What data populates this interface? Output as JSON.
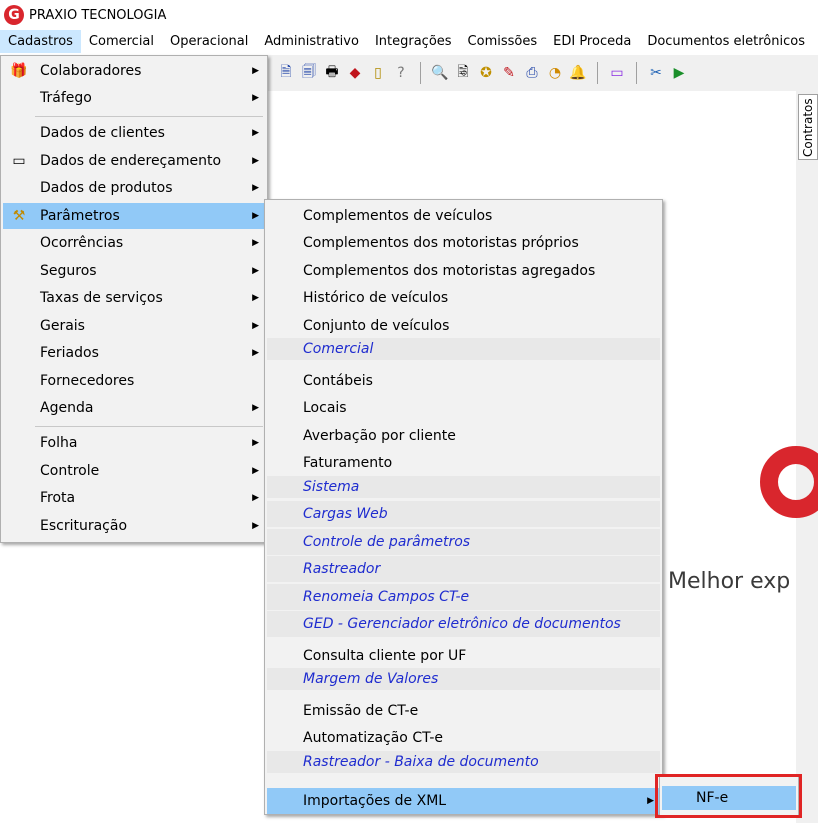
{
  "app": {
    "title": "PRAXIO TECNOLOGIA",
    "logo_letter": "G"
  },
  "menubar": [
    "Cadastros",
    "Comercial",
    "Operacional",
    "Administrativo",
    "Integrações",
    "Comissões",
    "EDI Proceda",
    "Documentos eletrônicos"
  ],
  "content": {
    "contratos_tab": "Contratos",
    "brand_text": "Melhor exp"
  },
  "menu_cadastros": {
    "items": [
      {
        "label": "Colaboradores",
        "icon": "gift-icon",
        "arrow": true
      },
      {
        "label": "Tráfego",
        "arrow": true
      },
      {
        "label": "Dados de clientes",
        "arrow": true
      },
      {
        "label": "Dados de endereçamento",
        "icon": "address-card-icon",
        "arrow": true
      },
      {
        "label": "Dados de produtos",
        "arrow": true
      },
      {
        "label": "Parâmetros",
        "icon": "tools-icon",
        "arrow": true
      },
      {
        "label": "Ocorrências",
        "arrow": true
      },
      {
        "label": "Seguros",
        "arrow": true
      },
      {
        "label": "Taxas de serviços",
        "arrow": true
      },
      {
        "label": "Gerais",
        "arrow": true
      },
      {
        "label": "Feriados",
        "arrow": true
      },
      {
        "label": "Fornecedores",
        "arrow": false
      },
      {
        "label": "Agenda",
        "arrow": true
      },
      {
        "label": "Folha",
        "arrow": true
      },
      {
        "label": "Controle",
        "arrow": true
      },
      {
        "label": "Frota",
        "arrow": true
      },
      {
        "label": "Escrituração",
        "arrow": true
      }
    ]
  },
  "menu_parametros": {
    "items": [
      {
        "label": "Complementos de veículos",
        "kind": "item"
      },
      {
        "label": "Complementos dos motoristas próprios",
        "kind": "item"
      },
      {
        "label": "Complementos dos motoristas agregados",
        "kind": "item"
      },
      {
        "label": "Histórico de veículos",
        "kind": "item"
      },
      {
        "label": "Conjunto de veículos",
        "kind": "item"
      },
      {
        "label": "Comercial",
        "kind": "category"
      },
      {
        "label": "Contábeis",
        "kind": "item"
      },
      {
        "label": "Locais",
        "kind": "item"
      },
      {
        "label": "Averbação por cliente",
        "kind": "item"
      },
      {
        "label": "Faturamento",
        "kind": "item"
      },
      {
        "label": "Sistema",
        "kind": "category"
      },
      {
        "label": "Cargas Web",
        "kind": "category"
      },
      {
        "label": "Controle de parâmetros",
        "kind": "category"
      },
      {
        "label": "Rastreador",
        "kind": "category"
      },
      {
        "label": "Renomeia Campos CT-e",
        "kind": "category"
      },
      {
        "label": "GED - Gerenciador eletrônico de documentos",
        "kind": "category"
      },
      {
        "label": "Consulta cliente por UF",
        "kind": "item"
      },
      {
        "label": "Margem de Valores",
        "kind": "category"
      },
      {
        "label": "Emissão de CT-e",
        "kind": "item"
      },
      {
        "label": "Automatização CT-e",
        "kind": "item"
      },
      {
        "label": "Rastreador - Baixa de documento",
        "kind": "category"
      },
      {
        "label": "Importações de XML",
        "kind": "highlight"
      }
    ]
  },
  "menu_importacoes": {
    "items": [
      {
        "label": "NF-e"
      }
    ]
  },
  "colors": {
    "highlight": "#91c9f7",
    "category_text": "#1f2ccf",
    "brand": "#d9262d",
    "callout": "#e02424"
  }
}
